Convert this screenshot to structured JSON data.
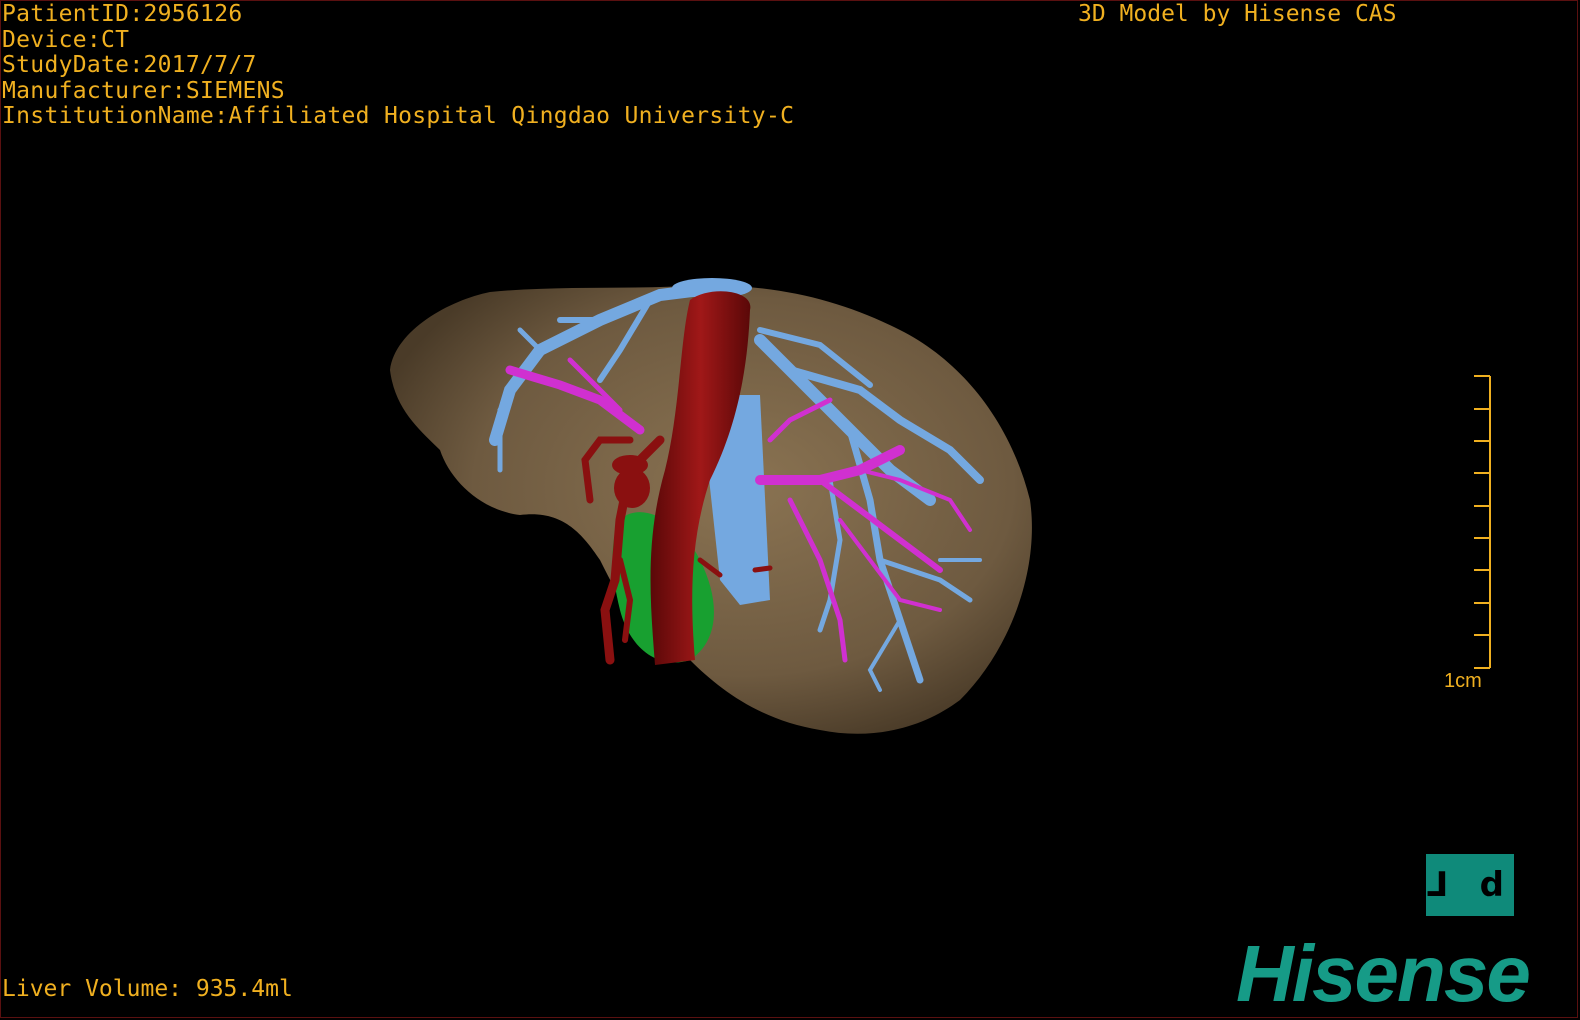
{
  "header": {
    "patient_id": "PatientID:2956126",
    "device": "Device:CT",
    "study_date": "StudyDate:2017/7/7",
    "manufacturer": "Manufacturer:SIEMENS",
    "institution": "InstitutionName:Affiliated Hospital Qingdao University-C"
  },
  "brand_top": "3D Model by Hisense CAS",
  "liver_volume": "Liver Volume: 935.4ml",
  "scale_bar": {
    "label": "1cm",
    "tick_count": 10
  },
  "orientation_cube": {
    "label": "⅃ d"
  },
  "logo": "Hisense",
  "colors": {
    "text": "#f0b020",
    "liver": "#7a6448",
    "hepatic_vein": "#74a8e0",
    "portal_vein": "#d030d0",
    "artery": "#8a1010",
    "gallbladder": "#18a030",
    "brand": "#169b87"
  },
  "icons": [
    "orientation-cube-icon",
    "hisense-logo"
  ]
}
